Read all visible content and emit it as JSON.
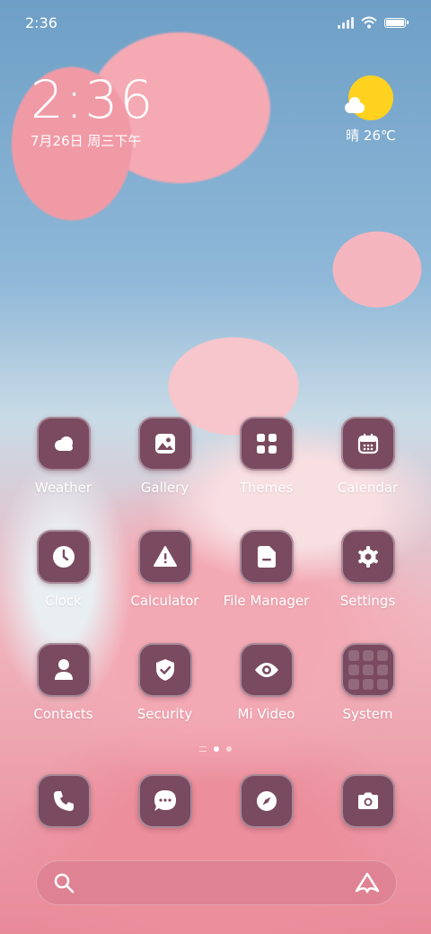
{
  "status_bar": {
    "time": "2:36"
  },
  "clock_widget": {
    "time": "2:36",
    "date": "7月26日 周三下午"
  },
  "weather_widget": {
    "condition_temp": "晴 26℃",
    "icon": "sun-cloud-icon"
  },
  "apps": [
    {
      "label": "Weather",
      "icon": "cloud-icon"
    },
    {
      "label": "Gallery",
      "icon": "image-icon"
    },
    {
      "label": "Themes",
      "icon": "grid-icon"
    },
    {
      "label": "Calendar",
      "icon": "calendar-icon"
    },
    {
      "label": "Clock",
      "icon": "clock-icon"
    },
    {
      "label": "Calculator",
      "icon": "warning-triangle-icon"
    },
    {
      "label": "File Manager",
      "icon": "folder-icon"
    },
    {
      "label": "Settings",
      "icon": "gear-icon"
    },
    {
      "label": "Contacts",
      "icon": "person-icon"
    },
    {
      "label": "Security",
      "icon": "shield-check-icon"
    },
    {
      "label": "Mi Video",
      "icon": "eye-icon"
    },
    {
      "label": "System",
      "icon": "folder-grid-icon"
    }
  ],
  "dock": [
    {
      "name": "phone",
      "icon": "phone-icon"
    },
    {
      "name": "messages",
      "icon": "chat-bubble-icon"
    },
    {
      "name": "browser",
      "icon": "compass-icon"
    },
    {
      "name": "camera",
      "icon": "camera-icon"
    }
  ],
  "search_bar": {
    "left_icon": "search-icon",
    "right_icon": "assistant-icon"
  },
  "colors": {
    "icon_bg": "#7a4a60",
    "sun": "#ffd21f",
    "text": "#ffffff"
  }
}
